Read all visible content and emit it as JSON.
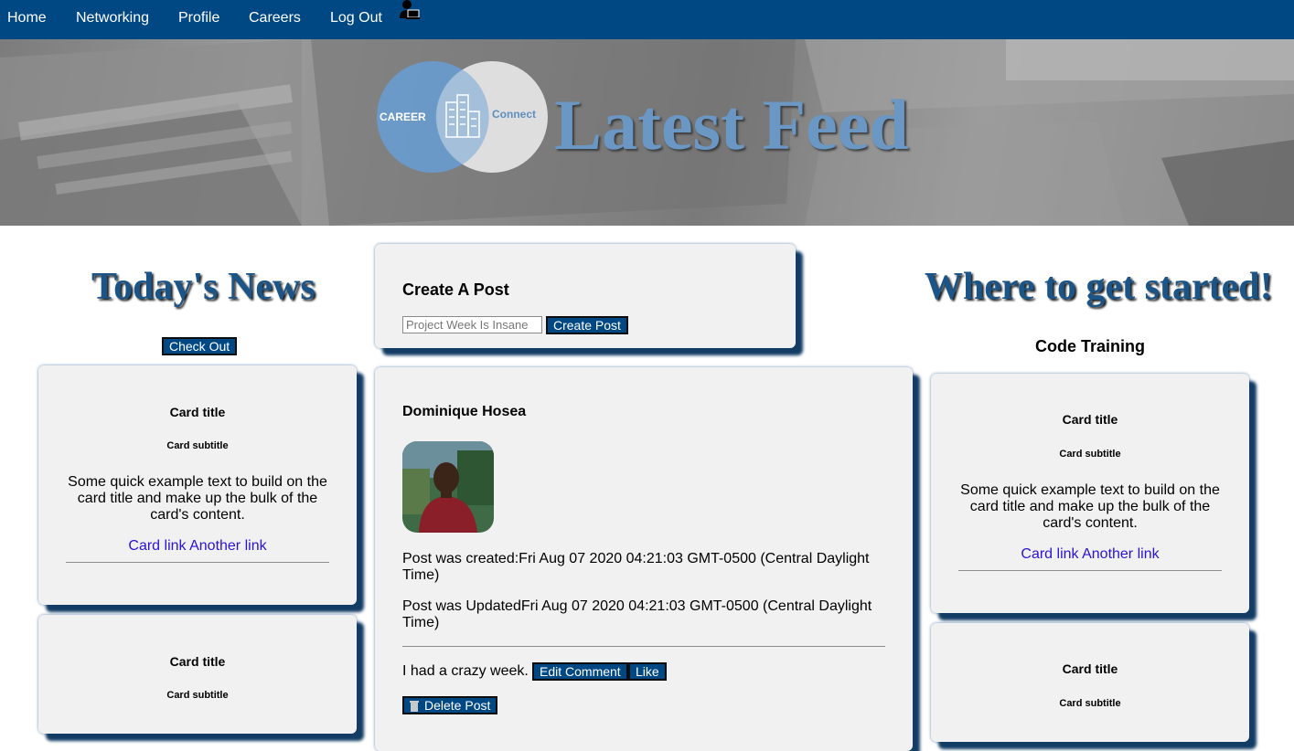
{
  "nav": {
    "items": [
      {
        "label": "Home"
      },
      {
        "label": "Networking"
      },
      {
        "label": "Profile"
      },
      {
        "label": "Careers"
      },
      {
        "label": "Log Out"
      }
    ],
    "user_icon": "user-computer-icon"
  },
  "hero": {
    "title": "Latest Feed",
    "logo": {
      "left_text": "CAREER",
      "right_text": "Connect",
      "icon": "buildings-icon"
    }
  },
  "news": {
    "heading": "Today's News",
    "button_label": "Check Out",
    "cards": [
      {
        "title": "Card title",
        "subtitle": "Card subtitle",
        "text": "Some quick example text to build on the card title and make up the bulk of the card's content.",
        "link1": "Card link",
        "link2": "Another link"
      },
      {
        "title": "Card title",
        "subtitle": "Card subtitle"
      }
    ]
  },
  "create_post": {
    "heading": "Create A Post",
    "input_placeholder": "Project Week Is Insane",
    "button_label": "Create Post"
  },
  "post": {
    "author": "Dominique Hosea",
    "created_label": "Post was created:",
    "created": "Fri Aug 07 2020 04:21:03 GMT-0500 (Central Daylight Time)",
    "updated_label": "Post was Updated",
    "updated": "Fri Aug 07 2020 04:21:03 GMT-0500 (Central Daylight Time)",
    "comment": "I had a crazy week.",
    "edit_label": "Edit Comment",
    "like_label": "Like",
    "delete_label": "Delete Post"
  },
  "started": {
    "heading": "Where to get started!",
    "subheading": "Code Training",
    "cards": [
      {
        "title": "Card title",
        "subtitle": "Card subtitle",
        "text": "Some quick example text to build on the card title and make up the bulk of the card's content.",
        "link1": "Card link",
        "link2": "Another link"
      },
      {
        "title": "Card title",
        "subtitle": "Card subtitle"
      }
    ]
  },
  "colors": {
    "nav": "#004884",
    "button": "#004884",
    "heading": "#1b5486",
    "hero_title": "#6b97c4",
    "card_bg": "#f1f1f1",
    "link": "#2a13d6"
  }
}
